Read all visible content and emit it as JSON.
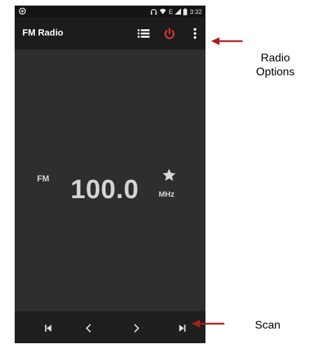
{
  "statusbar": {
    "time": "3:32",
    "network_label": "E",
    "icons": [
      "circle-app-icon",
      "headset-icon",
      "wifi-icon",
      "signal-icon",
      "battery-icon"
    ]
  },
  "appbar": {
    "title": "FM Radio",
    "icons": [
      "station-list-icon",
      "power-icon",
      "overflow-menu-icon"
    ],
    "power_color": "#e53935"
  },
  "tuner": {
    "band": "FM",
    "frequency": "100.0",
    "unit": "MHz",
    "favorite_icon": "star-icon"
  },
  "controls": {
    "icons": [
      "skip-previous-icon",
      "chevron-left-icon",
      "chevron-right-icon",
      "skip-next-icon"
    ]
  },
  "annotations": {
    "radio_options_line1": "Radio",
    "radio_options_line2": "Options",
    "scan": "Scan",
    "arrow_color": "#b01a1a"
  }
}
